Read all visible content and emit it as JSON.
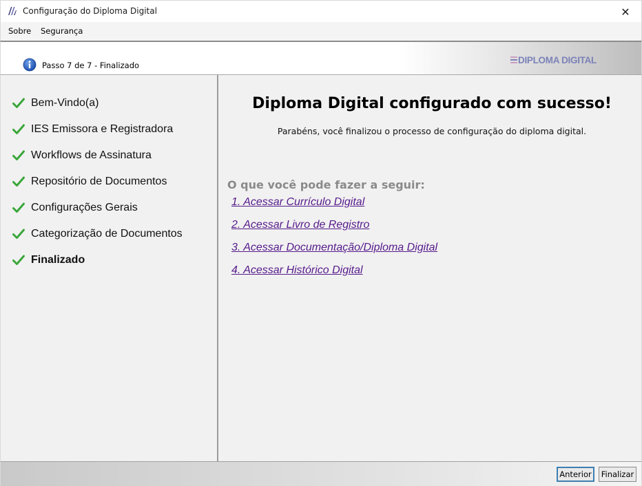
{
  "window": {
    "title": "Configuração do Diploma Digital",
    "close_glyph": "✕"
  },
  "menu": {
    "items": [
      "Sobre",
      "Segurança"
    ]
  },
  "header": {
    "step_text": "Passo 7 de 7 - Finalizado",
    "logo_text": "DIPLOMA DIGITAL",
    "info_icon": "info-icon"
  },
  "sidebar": {
    "steps": [
      {
        "label": "Bem-Vindo(a)",
        "done": true,
        "current": false
      },
      {
        "label": "IES Emissora e Registradora",
        "done": true,
        "current": false
      },
      {
        "label": "Workflows de Assinatura",
        "done": true,
        "current": false
      },
      {
        "label": "Repositório de Documentos",
        "done": true,
        "current": false
      },
      {
        "label": "Configurações Gerais",
        "done": true,
        "current": false
      },
      {
        "label": "Categorização de Documentos",
        "done": true,
        "current": false
      },
      {
        "label": "Finalizado",
        "done": true,
        "current": true
      }
    ]
  },
  "main": {
    "heading": "Diploma Digital configurado com sucesso!",
    "subtitle": "Parabéns, você finalizou o processo de configuração do diploma digital.",
    "next_title": "O que você pode fazer a seguir:",
    "links": [
      "1. Acessar Currículo Digital",
      "2. Acessar Livro de Registro",
      "3. Acessar Documentação/Diploma Digital",
      "4. Acessar Histórico Digital"
    ]
  },
  "footer": {
    "previous_label": "Anterior",
    "finish_label": "Finalizar"
  },
  "colors": {
    "link": "#551a8b",
    "check": "#3aa63a",
    "next_title": "#8a8a8a",
    "logo": "#7b82b8"
  }
}
